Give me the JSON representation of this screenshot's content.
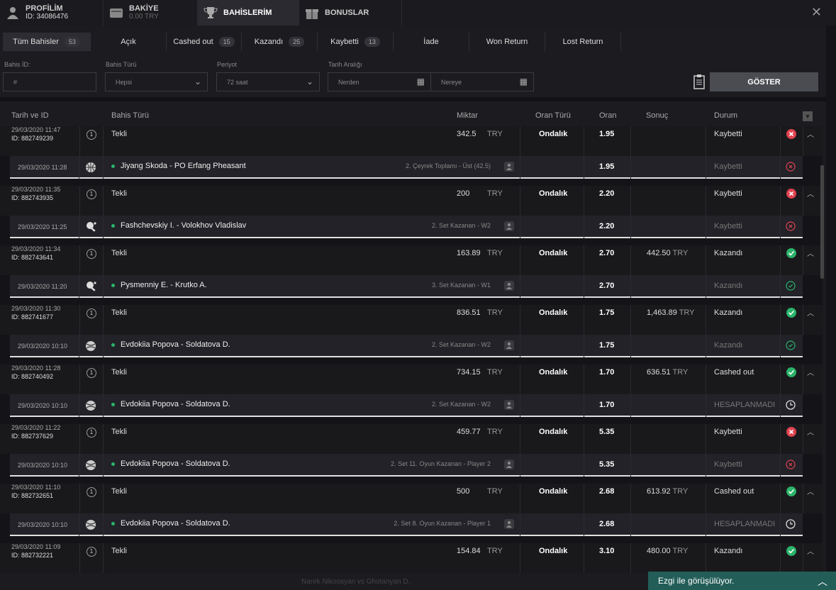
{
  "nav": {
    "profile": {
      "title": "PROFİLİM",
      "sub": "ID: 34086476"
    },
    "balance": {
      "title": "BAKİYE",
      "sub": "0.00 TRY"
    },
    "bets": {
      "title": "BAHİSLERİM"
    },
    "bonus": {
      "title": "BONUSLAR"
    }
  },
  "tabs": [
    {
      "label": "Tüm Bahisler",
      "count": "53"
    },
    {
      "label": "Açık",
      "count": ""
    },
    {
      "label": "Cashed out",
      "count": "15"
    },
    {
      "label": "Kazandı",
      "count": "25"
    },
    {
      "label": "Kaybetti",
      "count": "13"
    },
    {
      "label": "İade",
      "count": ""
    },
    {
      "label": "Won Return",
      "count": ""
    },
    {
      "label": "Lost Return",
      "count": ""
    }
  ],
  "filters": {
    "bet_id_label": "Bahis İD:",
    "bet_id_placeholder": "#",
    "bet_type_label": "Bahis Türü",
    "bet_type_value": "Hepsi",
    "period_label": "Periyot",
    "period_value": "72 saat",
    "date_range_label": "Tarih Aralığı",
    "from_placeholder": "Nerden",
    "to_placeholder": "Nereye",
    "show_button": "GÖSTER"
  },
  "table_headers": {
    "date_id": "Tarih ve ID",
    "bet_type": "Bahis Türü",
    "amount": "Miktar",
    "odds_type": "Oran Türü",
    "odds": "Oran",
    "result": "Sonuç",
    "status": "Durum"
  },
  "bets": [
    {
      "date": "29/03/2020 11:47",
      "id": "ID: 882749239",
      "type": "Tekli",
      "amount": "342.5",
      "currency": "TRY",
      "odds_type": "Ondalık",
      "odds": "1.95",
      "result": "",
      "result_currency": "",
      "status": "Kaybetti",
      "status_kind": "lost",
      "sel": {
        "date": "29/03/2020 11:28",
        "sport": "basketball-icon",
        "match": "Jiyang Skoda - PO Erfang Pheasant",
        "market": "2. Çeyrek Toplamı - Üst (42.5)",
        "odds": "1.95",
        "status": "Kaybetti",
        "status_kind": "lost"
      }
    },
    {
      "date": "29/03/2020 11:35",
      "id": "ID: 882743935",
      "type": "Tekli",
      "amount": "200",
      "currency": "TRY",
      "odds_type": "Ondalık",
      "odds": "2.20",
      "result": "",
      "result_currency": "",
      "status": "Kaybetti",
      "status_kind": "lost",
      "sel": {
        "date": "29/03/2020 11:25",
        "sport": "table-tennis-icon",
        "match": "Fashchevskiy I. - Volokhov Vladislav",
        "market": "2. Set Kazanan - W2",
        "odds": "2.20",
        "status": "Kaybetti",
        "status_kind": "lost"
      }
    },
    {
      "date": "29/03/2020 11:34",
      "id": "ID: 882743641",
      "type": "Tekli",
      "amount": "163.89",
      "currency": "TRY",
      "odds_type": "Ondalık",
      "odds": "2.70",
      "result": "442.50",
      "result_currency": "TRY",
      "status": "Kazandı",
      "status_kind": "won",
      "sel": {
        "date": "29/03/2020 11:20",
        "sport": "table-tennis-icon",
        "match": "Pysmenniy E. - Krutko A.",
        "market": "3. Set Kazanan - W1",
        "odds": "2.70",
        "status": "Kazandı",
        "status_kind": "won"
      }
    },
    {
      "date": "29/03/2020 11:30",
      "id": "ID: 882741677",
      "type": "Tekli",
      "amount": "836.51",
      "currency": "TRY",
      "odds_type": "Ondalık",
      "odds": "1.75",
      "result": "1,463.89",
      "result_currency": "TRY",
      "status": "Kazandı",
      "status_kind": "won",
      "sel": {
        "date": "29/03/2020 10:10",
        "sport": "tennis-icon",
        "match": "Evdokiia Popova - Soldatova D.",
        "market": "2. Set Kazanan - W2",
        "odds": "1.75",
        "status": "Kazandı",
        "status_kind": "won"
      }
    },
    {
      "date": "29/03/2020 11:28",
      "id": "ID: 882740492",
      "type": "Tekli",
      "amount": "734.15",
      "currency": "TRY",
      "odds_type": "Ondalık",
      "odds": "1.70",
      "result": "636.51",
      "result_currency": "TRY",
      "status": "Cashed out",
      "status_kind": "won",
      "sel": {
        "date": "29/03/2020 10:10",
        "sport": "tennis-icon",
        "match": "Evdokiia Popova - Soldatova D.",
        "market": "2. Set Kazanan - W2",
        "odds": "1.70",
        "status": "HESAPLANMADI",
        "status_kind": "pending"
      }
    },
    {
      "date": "29/03/2020 11:22",
      "id": "ID: 882737629",
      "type": "Tekli",
      "amount": "459.77",
      "currency": "TRY",
      "odds_type": "Ondalık",
      "odds": "5.35",
      "result": "",
      "result_currency": "",
      "status": "Kaybetti",
      "status_kind": "lost",
      "sel": {
        "date": "29/03/2020 10:10",
        "sport": "tennis-icon",
        "match": "Evdokiia Popova - Soldatova D.",
        "market": "2. Set 11. Oyun Kazanan - Player 2",
        "odds": "5.35",
        "status": "Kaybetti",
        "status_kind": "lost"
      }
    },
    {
      "date": "29/03/2020 11:10",
      "id": "ID: 882732651",
      "type": "Tekli",
      "amount": "500",
      "currency": "TRY",
      "odds_type": "Ondalık",
      "odds": "2.68",
      "result": "613.92",
      "result_currency": "TRY",
      "status": "Cashed out",
      "status_kind": "won",
      "sel": {
        "date": "29/03/2020 10:10",
        "sport": "tennis-icon",
        "match": "Evdokiia Popova - Soldatova D.",
        "market": "2. Set 8. Oyun Kazanan - Player 1",
        "odds": "2.68",
        "status": "HESAPLANMADI",
        "status_kind": "pending"
      }
    },
    {
      "date": "29/03/2020 11:09",
      "id": "ID: 882732221",
      "type": "Tekli",
      "amount": "154.84",
      "currency": "TRY",
      "odds_type": "Ondalık",
      "odds": "3.10",
      "result": "480.00",
      "result_currency": "TRY",
      "status": "Kazandı",
      "status_kind": "won",
      "sel": null
    }
  ],
  "chat": {
    "label": "Ezgi ile görüşülüyor."
  },
  "footer_ghost": "Narek Nikoosyan  vs  Ghotanyan D.",
  "colors": {
    "win": "#2bb36a",
    "lose": "#e04350",
    "accent": "#235d58"
  }
}
